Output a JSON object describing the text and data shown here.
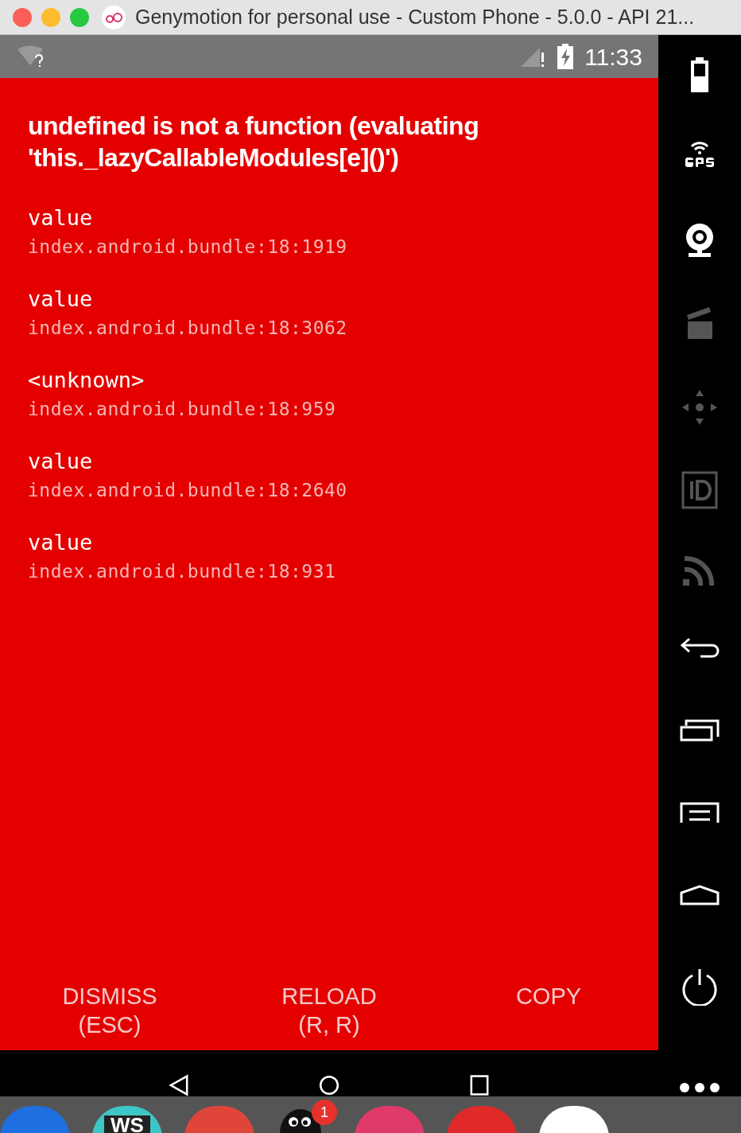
{
  "window": {
    "title": "Genymotion for personal use - Custom Phone - 5.0.0 - API 21..."
  },
  "status_bar": {
    "time": "11:33"
  },
  "error": {
    "message": "undefined is not a function (evaluating 'this._lazyCallableModules[e]()')",
    "frames": [
      {
        "method": "value",
        "location": "index.android.bundle:18:1919"
      },
      {
        "method": "value",
        "location": "index.android.bundle:18:3062"
      },
      {
        "method": "<unknown>",
        "location": "index.android.bundle:18:959"
      },
      {
        "method": "value",
        "location": "index.android.bundle:18:2640"
      },
      {
        "method": "value",
        "location": "index.android.bundle:18:931"
      }
    ]
  },
  "buttons": [
    {
      "label": "DISMISS",
      "shortcut": "(ESC)"
    },
    {
      "label": "RELOAD",
      "shortcut": "(R, R)"
    },
    {
      "label": "COPY"
    }
  ],
  "sidebar": {
    "tools": [
      {
        "kind": "battery",
        "disabled": false
      },
      {
        "kind": "gps",
        "disabled": false
      },
      {
        "kind": "webcam",
        "disabled": false
      },
      {
        "kind": "capture",
        "disabled": true
      },
      {
        "kind": "dpad",
        "disabled": true
      },
      {
        "kind": "id",
        "disabled": true
      },
      {
        "kind": "cast",
        "disabled": true
      },
      {
        "kind": "back",
        "disabled": false
      },
      {
        "kind": "recent",
        "disabled": false
      },
      {
        "kind": "menu",
        "disabled": false
      },
      {
        "kind": "home",
        "disabled": false
      },
      {
        "kind": "power",
        "disabled": false
      }
    ]
  },
  "dock": {
    "apps": [
      {
        "kind": "app",
        "color": "#1e6fe0"
      },
      {
        "kind": "app",
        "color": "#3ec5c5",
        "text": "WS"
      },
      {
        "kind": "app",
        "color": "#e0453a"
      },
      {
        "kind": "penguin",
        "badge": "1"
      },
      {
        "kind": "app",
        "color": "#e03a6a"
      },
      {
        "kind": "app",
        "color": "#e02a2a"
      },
      {
        "kind": "app",
        "color": "#ffffff"
      }
    ]
  }
}
